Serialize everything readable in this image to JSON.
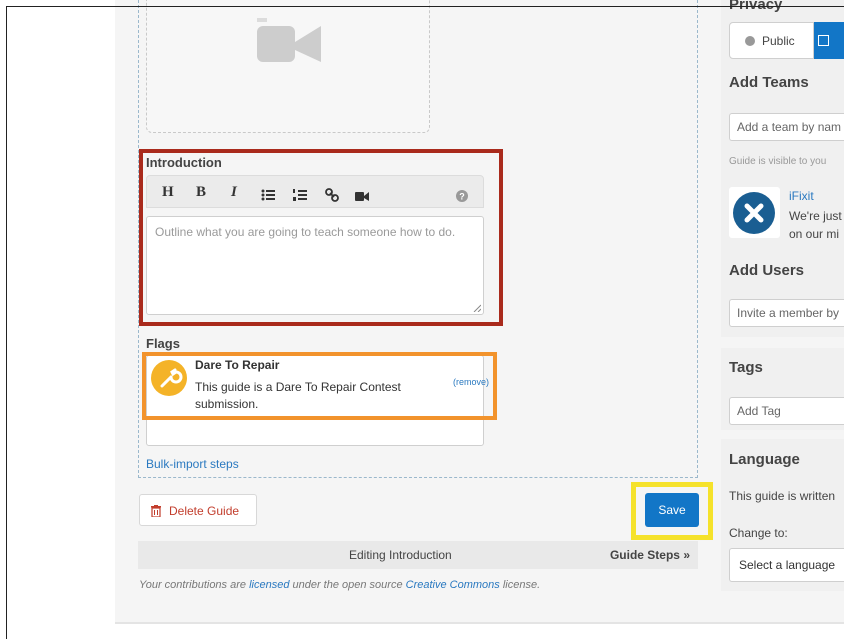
{
  "editor": {
    "intro_label": "Introduction",
    "toolbar": {
      "heading": "H",
      "bold": "B",
      "italic": "I",
      "bullet_list": "≡",
      "numbered_list": "≡",
      "link": "%",
      "video": "■",
      "help": "?"
    },
    "intro_placeholder": "Outline what you are going to teach someone how to do.",
    "flags_label": "Flags",
    "flag": {
      "title": "Dare To Repair",
      "description": "This guide is a Dare To Repair Contest submission.",
      "remove": "(remove)"
    },
    "bulk_import": "Bulk-import steps",
    "delete_label": "Delete Guide",
    "save_label": "Save",
    "step_bar": {
      "current": "Editing Introduction",
      "next": "Guide Steps »"
    },
    "footer": {
      "prefix": "Your contributions are ",
      "licensed": "licensed",
      "middle": " under the open source ",
      "cc": "Creative Commons",
      "suffix": " license."
    }
  },
  "sidebar": {
    "privacy_heading": "Privacy",
    "privacy_public": "Public",
    "add_teams_heading": "Add Teams",
    "add_team_placeholder": "Add a team by nam",
    "guide_visible": "Guide is visible to you",
    "team_name": "iFixit",
    "team_desc_1": "We're just",
    "team_desc_2": "on our mi",
    "add_users_heading": "Add Users",
    "invite_placeholder": "Invite a member by",
    "tags_heading": "Tags",
    "add_tag_placeholder": "Add Tag",
    "language_heading": "Language",
    "language_text": "This guide is written",
    "change_to": "Change to:",
    "select_language": "Select a language"
  },
  "colors": {
    "primary": "#1276c7",
    "intro_highlight": "#a92a1c",
    "flag_highlight": "#f2932c",
    "save_highlight": "#f5e22b",
    "delete_text": "#c23d2c"
  }
}
